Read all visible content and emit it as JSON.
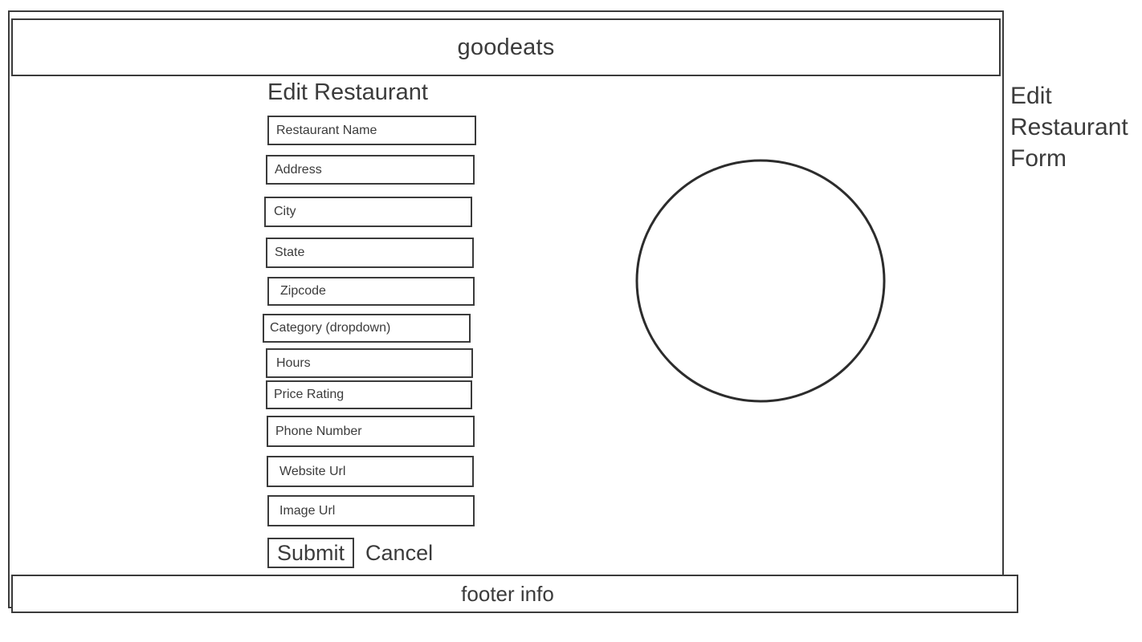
{
  "header": {
    "brand": "goodeats"
  },
  "main": {
    "heading": "Edit Restaurant",
    "fields": [
      {
        "label": "Restaurant Name",
        "type": "text"
      },
      {
        "label": "Address",
        "type": "text"
      },
      {
        "label": "City",
        "type": "text"
      },
      {
        "label": "State",
        "type": "text"
      },
      {
        "label": "Zipcode",
        "type": "text"
      },
      {
        "label": "Category (dropdown)",
        "type": "dropdown"
      },
      {
        "label": "Hours",
        "type": "text"
      },
      {
        "label": "Price Rating",
        "type": "text"
      },
      {
        "label": "Phone Number",
        "type": "text"
      },
      {
        "label": "Website Url",
        "type": "text"
      },
      {
        "label": "Image Url",
        "type": "text"
      }
    ],
    "submit_label": "Submit",
    "cancel_label": "Cancel",
    "image_placeholder": "image-placeholder-circle"
  },
  "footer": {
    "text": "footer info"
  },
  "annotation": {
    "text": "Edit Restaurant Form"
  },
  "colors": {
    "stroke": "#3b3b3b",
    "background": "#ffffff"
  }
}
